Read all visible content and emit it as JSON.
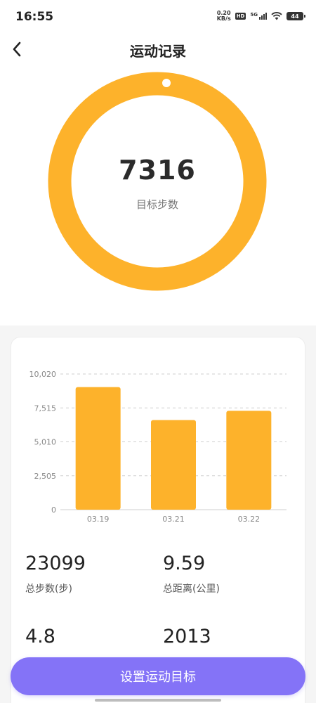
{
  "status_bar": {
    "time": "16:55",
    "net_speed_value": "0.20",
    "net_speed_unit": "KB/s",
    "hd_label": "HD",
    "network_label": "5G",
    "battery": "44"
  },
  "nav": {
    "title": "运动记录",
    "back_icon": "chevron-left-icon"
  },
  "ring": {
    "value": "7316",
    "label": "目标步数",
    "color": "#FDB22B",
    "progress_fraction": 1.0
  },
  "chart_data": {
    "type": "bar",
    "categories": [
      "03.19",
      "03.21",
      "03.22"
    ],
    "values": [
      9050,
      6620,
      7300
    ],
    "ylim": [
      0,
      10020
    ],
    "yticks": [
      "0",
      "2,505",
      "5,010",
      "7,515",
      "10,020"
    ],
    "ytick_values": [
      0,
      2505,
      5010,
      7515,
      10020
    ],
    "grid": true,
    "bar_color": "#FDB22B",
    "title": "",
    "xlabel": "",
    "ylabel": ""
  },
  "stats": [
    {
      "value": "23099",
      "label": "总步数(步)"
    },
    {
      "value": "9.59",
      "label": "总距离(公里)"
    },
    {
      "value": "4.8",
      "label": ""
    },
    {
      "value": "2013",
      "label": ""
    }
  ],
  "action_button": {
    "label": "设置运动目标",
    "color": "#8473F7"
  }
}
